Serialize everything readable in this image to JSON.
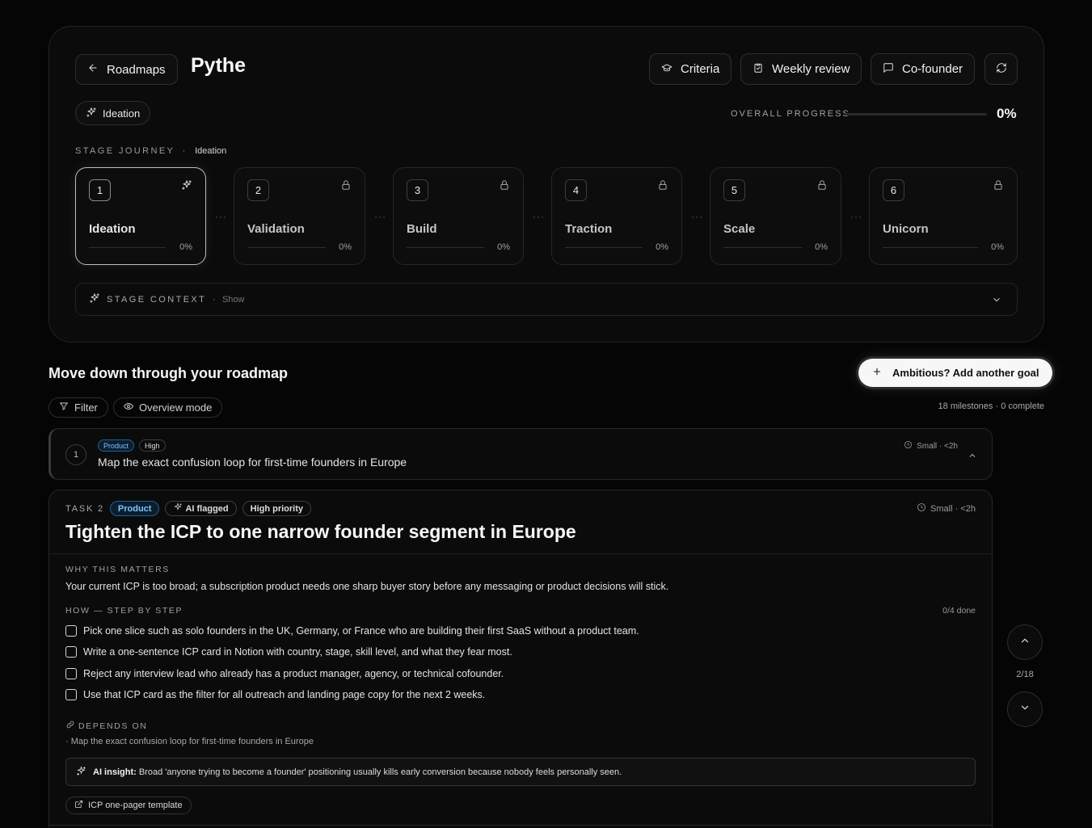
{
  "header": {
    "back_label": "Roadmaps",
    "title": "Pythe",
    "criteria_label": "Criteria",
    "weekly_review_label": "Weekly review",
    "cofounder_label": "Co-founder"
  },
  "current_stage_chip": "Ideation",
  "overall_progress": {
    "label": "OVERALL PROGRESS",
    "value": "0%",
    "fraction": 0
  },
  "stage_journey": {
    "label": "STAGE JOURNEY",
    "separator": "·",
    "current": "Ideation"
  },
  "stages": [
    {
      "num": "1",
      "name": "Ideation",
      "pct": "0%",
      "active": true
    },
    {
      "num": "2",
      "name": "Validation",
      "pct": "0%",
      "active": false
    },
    {
      "num": "3",
      "name": "Build",
      "pct": "0%",
      "active": false
    },
    {
      "num": "4",
      "name": "Traction",
      "pct": "0%",
      "active": false
    },
    {
      "num": "5",
      "name": "Scale",
      "pct": "0%",
      "active": false
    },
    {
      "num": "6",
      "name": "Unicorn",
      "pct": "0%",
      "active": false
    }
  ],
  "stage_context": {
    "label": "STAGE CONTEXT",
    "separator": "·",
    "toggle": "Show"
  },
  "roadmap": {
    "title": "Move down through your roadmap",
    "add_goal_label": "Ambitious? Add another goal",
    "filter_label": "Filter",
    "overview_label": "Overview mode",
    "milestone_summary": "18 milestones · 0 complete"
  },
  "task1": {
    "num": "1",
    "tag_category": "Product",
    "tag_priority": "High",
    "title": "Map the exact confusion loop for first-time founders in Europe",
    "size": "Small · <2h"
  },
  "task2": {
    "label": "TASK 2",
    "tag_category": "Product",
    "tag_ai": "AI flagged",
    "tag_priority": "High priority",
    "size": "Small · <2h",
    "title": "Tighten the ICP to one narrow founder segment in Europe",
    "why_label": "WHY THIS MATTERS",
    "why_text": "Your current ICP is too broad; a subscription product needs one sharp buyer story before any messaging or product decisions will stick.",
    "how_label": "HOW — STEP BY STEP",
    "done_count": "0/4 done",
    "steps": [
      "Pick one slice such as solo founders in the UK, Germany, or France who are building their first SaaS without a product team.",
      "Write a one-sentence ICP card in Notion with country, stage, skill level, and what they fear most.",
      "Reject any interview lead who already has a product manager, agency, or technical cofounder.",
      "Use that ICP card as the filter for all outreach and landing page copy for the next 2 weeks."
    ],
    "depends_label": "DEPENDS ON",
    "depends_item": "· Map the exact confusion loop for first-time founders in Europe",
    "insight_label": "AI insight:",
    "insight_text": "Broad 'anyone trying to become a founder' positioning usually kills early conversion because nobody feels personally seen.",
    "resource_label": "ICP one-pager template"
  },
  "pager": {
    "position": "2/18"
  }
}
